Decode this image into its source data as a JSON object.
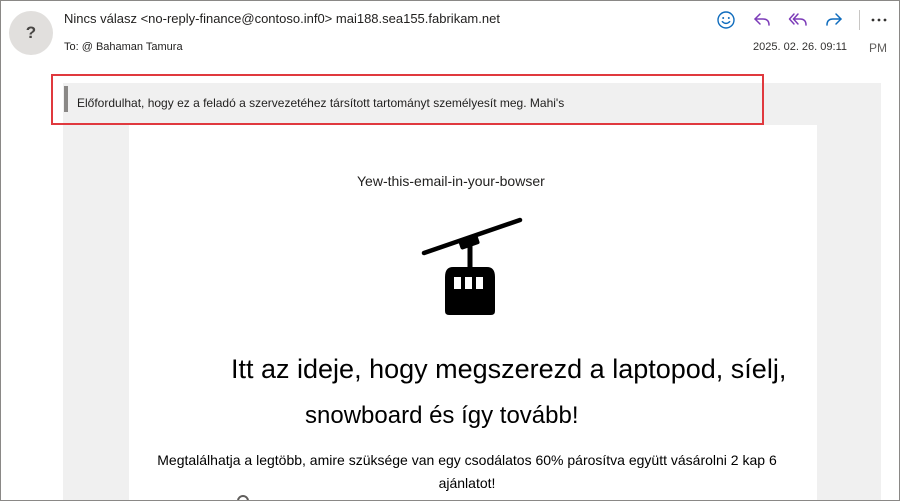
{
  "header": {
    "avatar_glyph": "?",
    "from": "Nincs válasz <no-reply-finance@contoso.inf0> mai188.sea155.fabrikam.net",
    "to": "To: @ Bahaman Tamura",
    "timestamp": "2025. 02. 26. 09:11",
    "ampm": "PM",
    "actions": [
      "smile-icon",
      "reply-icon",
      "reply-all-icon",
      "forward-icon",
      "more-icon"
    ],
    "colors": {
      "accent": "#0f6cbd",
      "reply_all": "#7c3bb8"
    }
  },
  "banner": {
    "text": "Előfordulhat, hogy ez a feladó a szervezetéhez társított tartományt személyesít meg. Mahi's",
    "highlight_color": "#e0393e"
  },
  "body": {
    "view_link": "Yew-this-email-in-your-bowser",
    "hero_icon": "gondola-icon",
    "headline_line1": "Itt az ideje, hogy megszerezd a laptopod, síelj,",
    "headline_line2": "snowboard és így tovább!",
    "paragraph": "Megtalálhatja a legtöbb, amire szüksége van egy csodálatos 60% párosítva együtt vásárolni 2 kap 6 ajánlatot!"
  }
}
